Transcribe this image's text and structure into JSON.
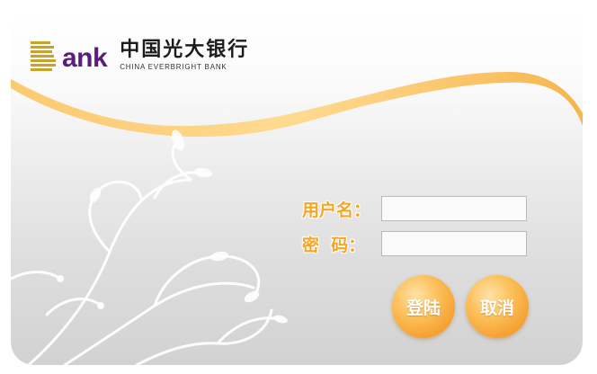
{
  "logo": {
    "brand": "ank",
    "name_cn": "中国光大银行",
    "name_en": "CHINA EVERBRIGHT BANK"
  },
  "form": {
    "username_label": "用户名：",
    "password_label": "密  码：",
    "username_value": "",
    "password_value": ""
  },
  "buttons": {
    "login_label": "登陆",
    "cancel_label": "取消"
  },
  "colors": {
    "accent": "#f5a623",
    "brand_purple": "#5a1e7a",
    "brand_gold": "#c9a227"
  },
  "icons": {
    "logo_mark": "gold-striped-b-icon",
    "decoration": "floral-swirl-icon"
  }
}
